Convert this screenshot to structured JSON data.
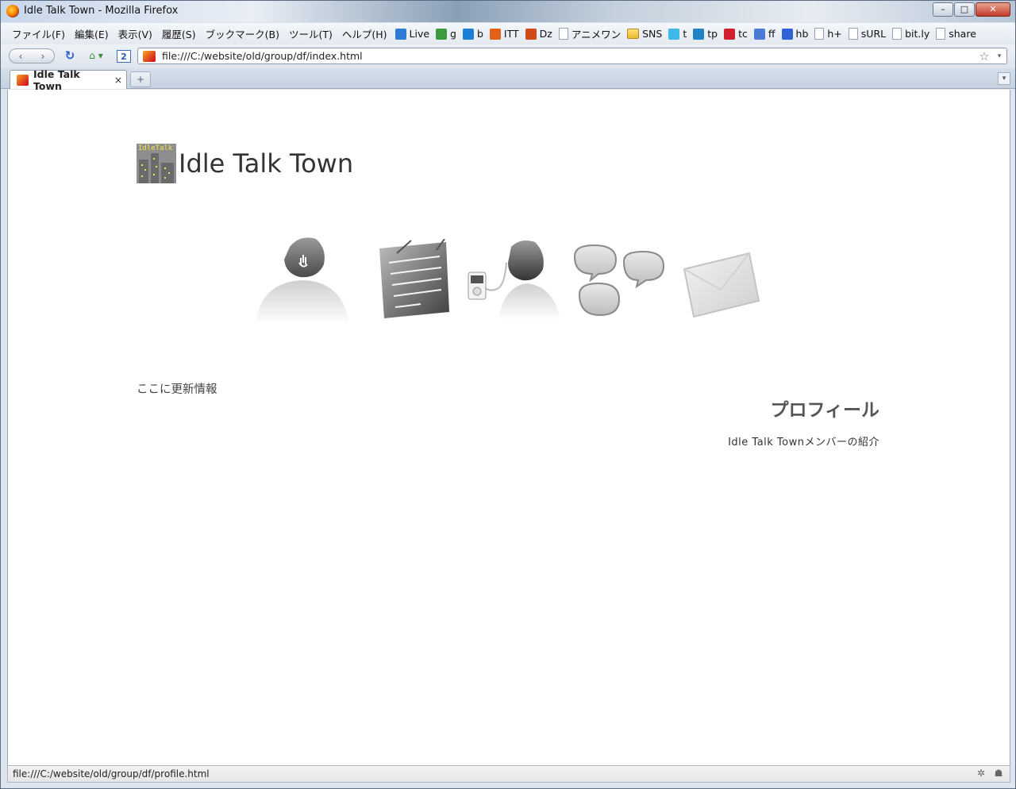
{
  "window": {
    "title": "Idle Talk Town - Mozilla Firefox",
    "minimize": "–",
    "maximize": "□",
    "close": "✕"
  },
  "menu": [
    "ファイル(F)",
    "編集(E)",
    "表示(V)",
    "履歴(S)",
    "ブックマーク(B)",
    "ツール(T)",
    "ヘルプ(H)"
  ],
  "bookmarks": [
    {
      "label": "Live",
      "icon": "windows-live-icon",
      "color": "#2e7bd6"
    },
    {
      "label": "g",
      "icon": "google-icon",
      "color": "#3c9b3c"
    },
    {
      "label": "b",
      "icon": "bing-icon",
      "color": "#1b7fd6"
    },
    {
      "label": "ITT",
      "icon": "itt-icon",
      "color": "#e2601a"
    },
    {
      "label": "Dz",
      "icon": "dz-icon",
      "color": "#d04a1a"
    },
    {
      "label": "アニメワン",
      "icon": "page-icon",
      "color": ""
    },
    {
      "label": "SNS",
      "icon": "folder-icon",
      "color": ""
    },
    {
      "label": "t",
      "icon": "twitter-icon",
      "color": "#3fb7e8"
    },
    {
      "label": "tp",
      "icon": "tp-icon",
      "color": "#1f82c6"
    },
    {
      "label": "tc",
      "icon": "tc-icon",
      "color": "#d01f2d"
    },
    {
      "label": "ff",
      "icon": "friendfeed-icon",
      "color": "#4a7bd6"
    },
    {
      "label": "hb",
      "icon": "hatena-bookmark-icon",
      "color": "#2e62d4"
    },
    {
      "label": "h+",
      "icon": "page-icon",
      "color": ""
    },
    {
      "label": "sURL",
      "icon": "page-icon",
      "color": ""
    },
    {
      "label": "bit.ly",
      "icon": "page-icon",
      "color": ""
    },
    {
      "label": "share",
      "icon": "page-icon",
      "color": ""
    }
  ],
  "nav": {
    "url": "file:///C:/website/old/group/df/index.html",
    "tab_count": "2"
  },
  "tab": {
    "label": "Idle Talk Town",
    "close": "×",
    "new_tab": "+"
  },
  "page": {
    "logo_text": "Idle Talk Town",
    "logo_mark_text": "IdleTalk",
    "update_text": "ここに更新情報",
    "profile_title": "プロフィール",
    "profile_desc": "Idle Talk Townメンバーの紹介"
  },
  "nav_icons": [
    {
      "name": "profile-person-icon"
    },
    {
      "name": "notes-document-icon"
    },
    {
      "name": "music-person-icon"
    },
    {
      "name": "chat-bubbles-icon"
    },
    {
      "name": "mail-envelope-icon"
    }
  ],
  "status": {
    "text": "file:///C:/website/old/group/df/profile.html"
  }
}
